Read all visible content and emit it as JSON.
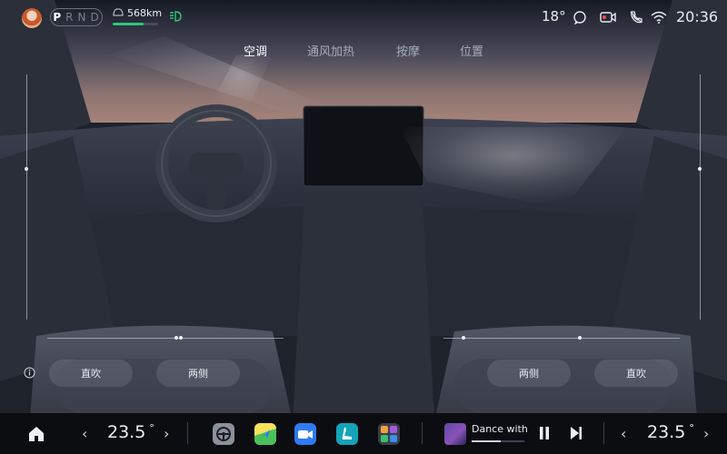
{
  "status_bar": {
    "gears": [
      "P",
      "R",
      "N",
      "D"
    ],
    "active_gear": "P",
    "range": "568km",
    "range_level": 0.68,
    "temperature": "18°",
    "time": "20:36",
    "icons": [
      "profile-avatar",
      "car-battery-icon",
      "headlight-icon",
      "message-icon",
      "dashcam-icon",
      "phone-icon",
      "wifi-icon"
    ]
  },
  "tabs": [
    {
      "label": "空调",
      "active": true
    },
    {
      "label": "通风加热",
      "active": false
    },
    {
      "label": "按摩",
      "active": false
    },
    {
      "label": "位置",
      "active": false
    }
  ],
  "vents": {
    "left_direct": "直吹",
    "left_sides": "两侧",
    "right_sides": "两侧",
    "right_direct": "直吹"
  },
  "dock": {
    "left_temp": "23.5",
    "right_temp": "23.5",
    "temp_unit": "°",
    "apps": [
      "steering-wheel-app",
      "maps-app",
      "video-call-app",
      "seat-app",
      "app-grid"
    ],
    "media": {
      "title": "Dance with",
      "progress": 0.55
    },
    "icons": [
      "home-icon",
      "chevron-left-icon",
      "chevron-right-icon",
      "pause-icon",
      "next-track-icon"
    ]
  },
  "colors": {
    "accent_green": "#2ec77a",
    "maps_green": "#4bbf5a",
    "video_blue": "#2d7bf4",
    "seat_teal": "#14a3b8",
    "dock_bg": "#0c0d11"
  }
}
